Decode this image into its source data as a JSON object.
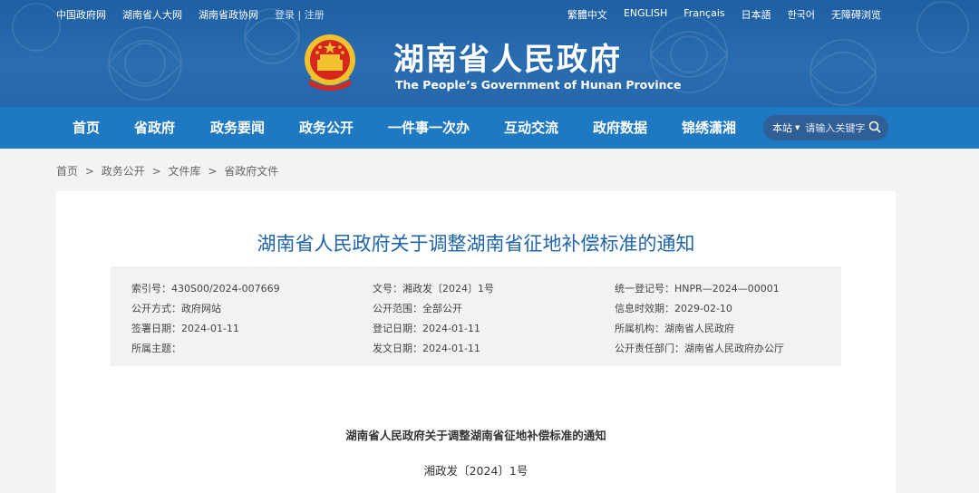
{
  "topbar": {
    "left_links": [
      "中国政府网",
      "湖南省人大网",
      "湖南省政协网"
    ],
    "login": "登录",
    "separator": "|",
    "register": "注册",
    "languages": [
      "繁體中文",
      "ENGLISH",
      "Français",
      "日本語",
      "한국어",
      "无障碍浏览"
    ]
  },
  "header": {
    "title": "湖南省人民政府",
    "subtitle": "The People’s Government of Hunan Province"
  },
  "nav": {
    "items": [
      "首页",
      "省政府",
      "政务要闻",
      "政务公开",
      "一件事一次办",
      "互动交流",
      "政府数据",
      "锦绣潇湘"
    ],
    "search": {
      "scope": "本站",
      "placeholder": "请输入关键字"
    }
  },
  "breadcrumb": [
    "首页",
    "政务公开",
    "文件库",
    "省政府文件"
  ],
  "breadcrumb_sep": ">",
  "document": {
    "title": "湖南省人民政府关于调整湖南省征地补偿标准的通知",
    "meta": [
      {
        "label": "索引号：",
        "value": "430S00/2024-007669"
      },
      {
        "label": "文号：",
        "value": "湘政发〔2024〕1号"
      },
      {
        "label": "统一登记号：",
        "value": "HNPR—2024—00001"
      },
      {
        "label": "公开方式：",
        "value": "政府网站"
      },
      {
        "label": "公开范围：",
        "value": "全部公开"
      },
      {
        "label": "信息时效期：",
        "value": "2029-02-10"
      },
      {
        "label": "签署日期：",
        "value": "2024-01-11"
      },
      {
        "label": "登记日期：",
        "value": "2024-01-11"
      },
      {
        "label": "所属机构：",
        "value": "湖南省人民政府"
      },
      {
        "label": "所属主题：",
        "value": ""
      },
      {
        "label": "发文日期：",
        "value": "2024-01-11"
      },
      {
        "label": "公开责任部门：",
        "value": "湖南省人民政府办公厅"
      }
    ],
    "body_title": "湖南省人民政府关于调整湖南省征地补偿标准的通知",
    "body_number": "湘政发〔2024〕1号"
  },
  "colors": {
    "header_blue": "#2a6db0",
    "nav_blue": "#1e78c2",
    "title_blue": "#1f63a8"
  }
}
